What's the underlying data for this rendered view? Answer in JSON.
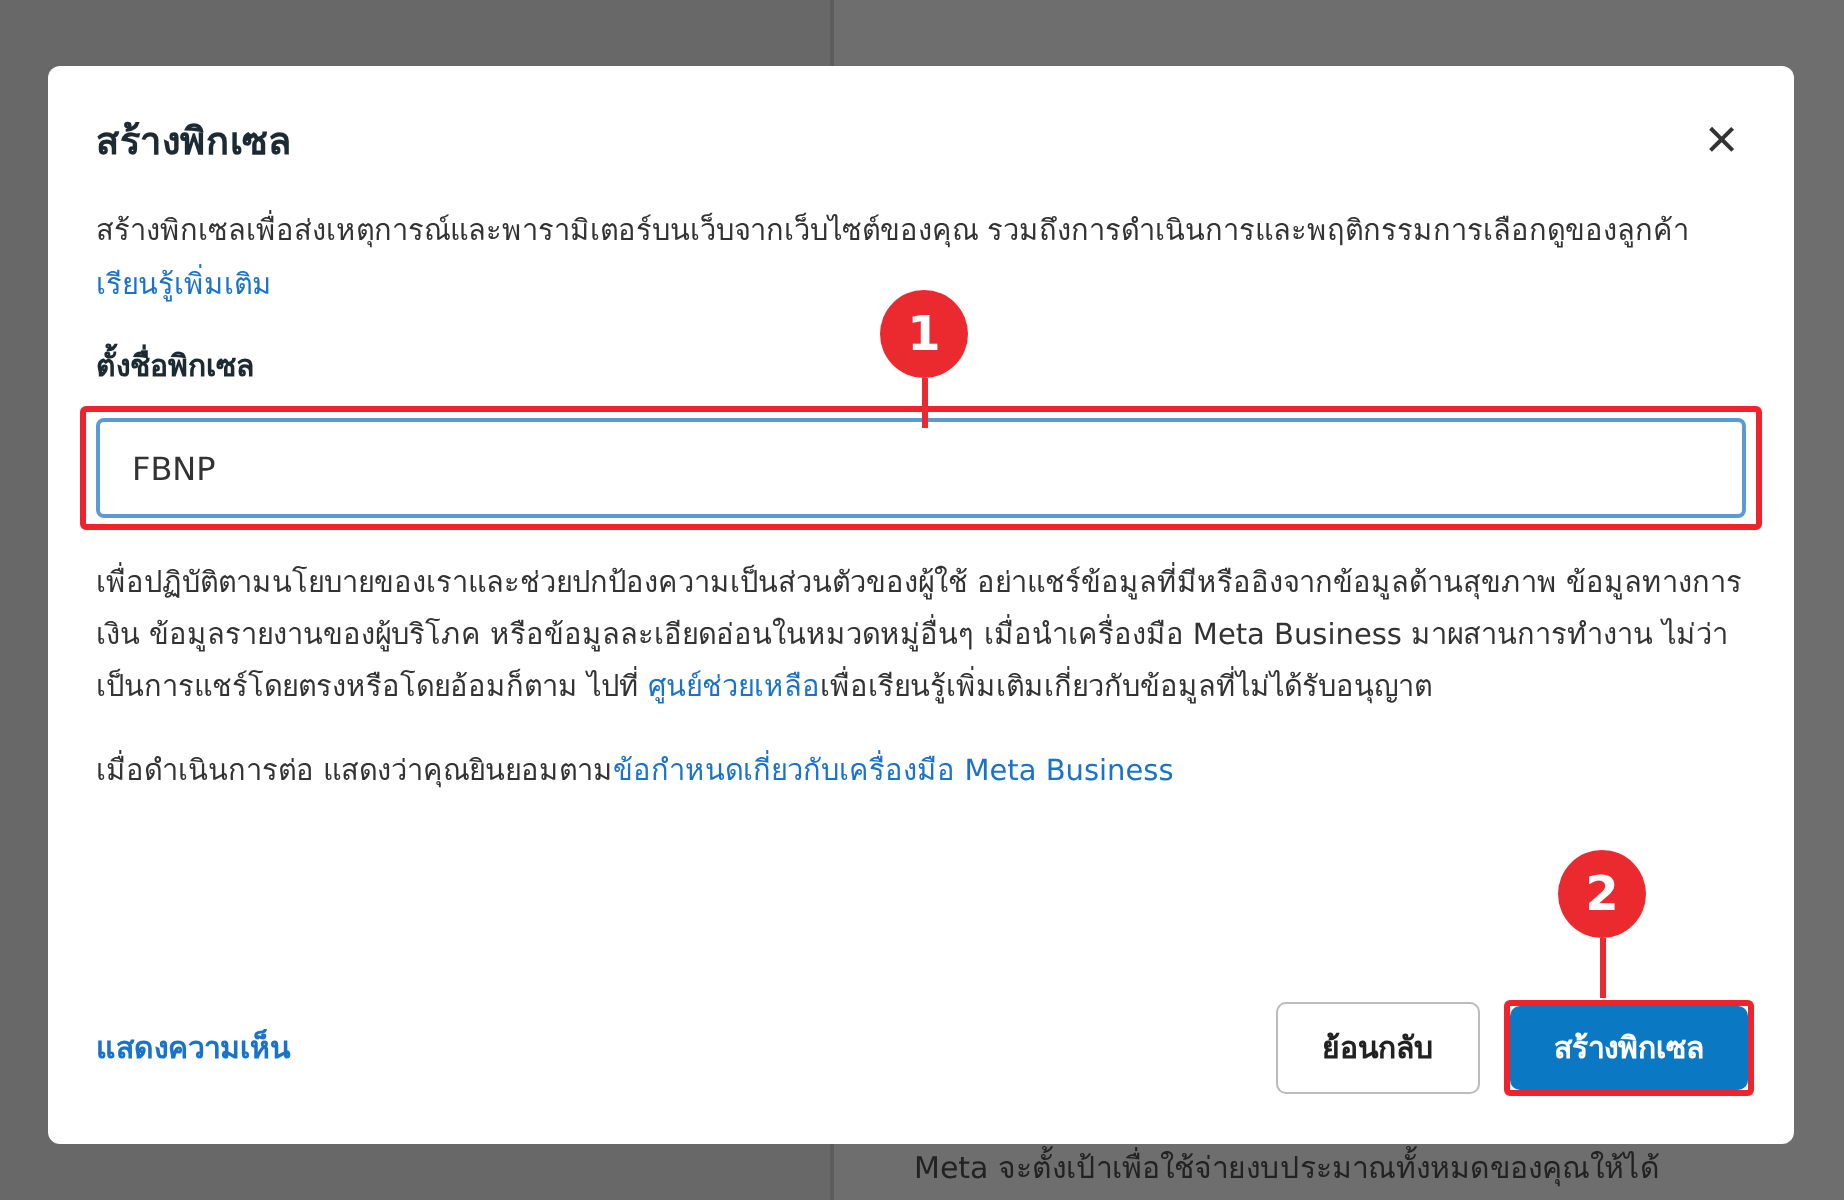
{
  "background": {
    "footer_text": "Meta จะตั้งเป้าเพื่อใช้จ่ายงบประมาณทั้งหมดของคุณให้ได้"
  },
  "dialog": {
    "title": "สร้างพิกเซล",
    "close": "×",
    "description": {
      "text": "สร้างพิกเซลเพื่อส่งเหตุการณ์และพารามิเตอร์บนเว็บจากเว็บไซต์ของคุณ รวมถึงการดำเนินการและพฤติกรรมการเลือกดูของลูกค้า",
      "link": "เรียนรู้เพิ่มเติม"
    },
    "field": {
      "label": "ตั้งชื่อพิกเซล",
      "value": "FBNP"
    },
    "policy": {
      "text_before": "เพื่อปฏิบัติตามนโยบายของเราและช่วยปกป้องความเป็นส่วนตัวของผู้ใช้ อย่าแชร์ข้อมูลที่มีหรืออิงจากข้อมูลด้านสุขภาพ ข้อมูลทางการเงิน ข้อมูลรายงานของผู้บริโภค หรือข้อมูลละเอียดอ่อนในหมวดหมู่อื่นๆ เมื่อนำเครื่องมือ Meta Business มาผสานการทำงาน ไม่ว่าเป็นการแชร์โดยตรงหรือโดยอ้อมก็ตาม ไปที่",
      "link": "ศูนย์ช่วยเหลือ",
      "text_after": "เพื่อเรียนรู้เพิ่มเติมเกี่ยวกับข้อมูลที่ไม่ได้รับอนุญาต"
    },
    "consent": {
      "text": "เมื่อดำเนินการต่อ แสดงว่าคุณยินยอมตาม",
      "link": "ข้อกำหนดเกี่ยวกับเครื่องมือ Meta Business"
    },
    "feedback_link": "แสดงความเห็น",
    "buttons": [
      {
        "label": "ย้อนกลับ",
        "kind": "secondary"
      },
      {
        "label": "สร้างพิกเซล",
        "kind": "primary"
      }
    ]
  },
  "annotations": [
    {
      "label": "1"
    },
    {
      "label": "2"
    }
  ]
}
